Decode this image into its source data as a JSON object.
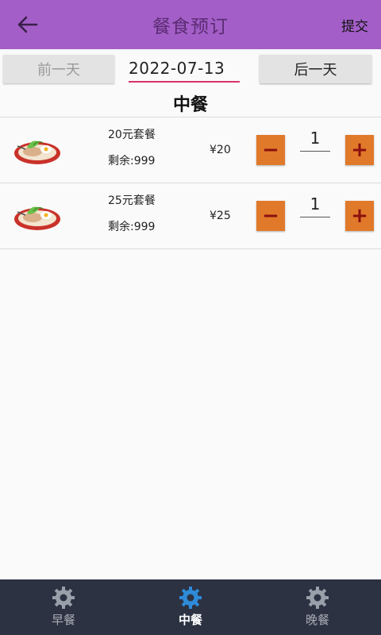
{
  "header": {
    "title": "餐食预订",
    "submit_label": "提交",
    "back_icon": "back-arrow-icon"
  },
  "date_bar": {
    "prev_label": "前一天",
    "date_value": "2022-07-13",
    "next_label": "后一天"
  },
  "meal_title": "中餐",
  "items": [
    {
      "name": "20元套餐",
      "remaining": "剩余:999",
      "price": "¥20",
      "quantity": "1",
      "image_icon": "meal-plate-icon"
    },
    {
      "name": "25元套餐",
      "remaining": "剩余:999",
      "price": "¥25",
      "quantity": "1",
      "image_icon": "meal-plate-icon"
    }
  ],
  "tabs": [
    {
      "label": "早餐",
      "icon": "gear-icon",
      "active": false
    },
    {
      "label": "中餐",
      "icon": "gear-icon",
      "active": true
    },
    {
      "label": "晚餐",
      "icon": "gear-icon",
      "active": false
    }
  ],
  "colors": {
    "header_bg": "#a35fc7",
    "title_text": "#5b2b74",
    "stepper_bg": "#e07a2a",
    "stepper_symbol": "#8b1010",
    "date_underline": "#d8336b",
    "bottom_bar_bg": "#2c3242",
    "tab_icon_inactive": "#9aa0aa",
    "tab_icon_active": "#2e8bd8"
  }
}
